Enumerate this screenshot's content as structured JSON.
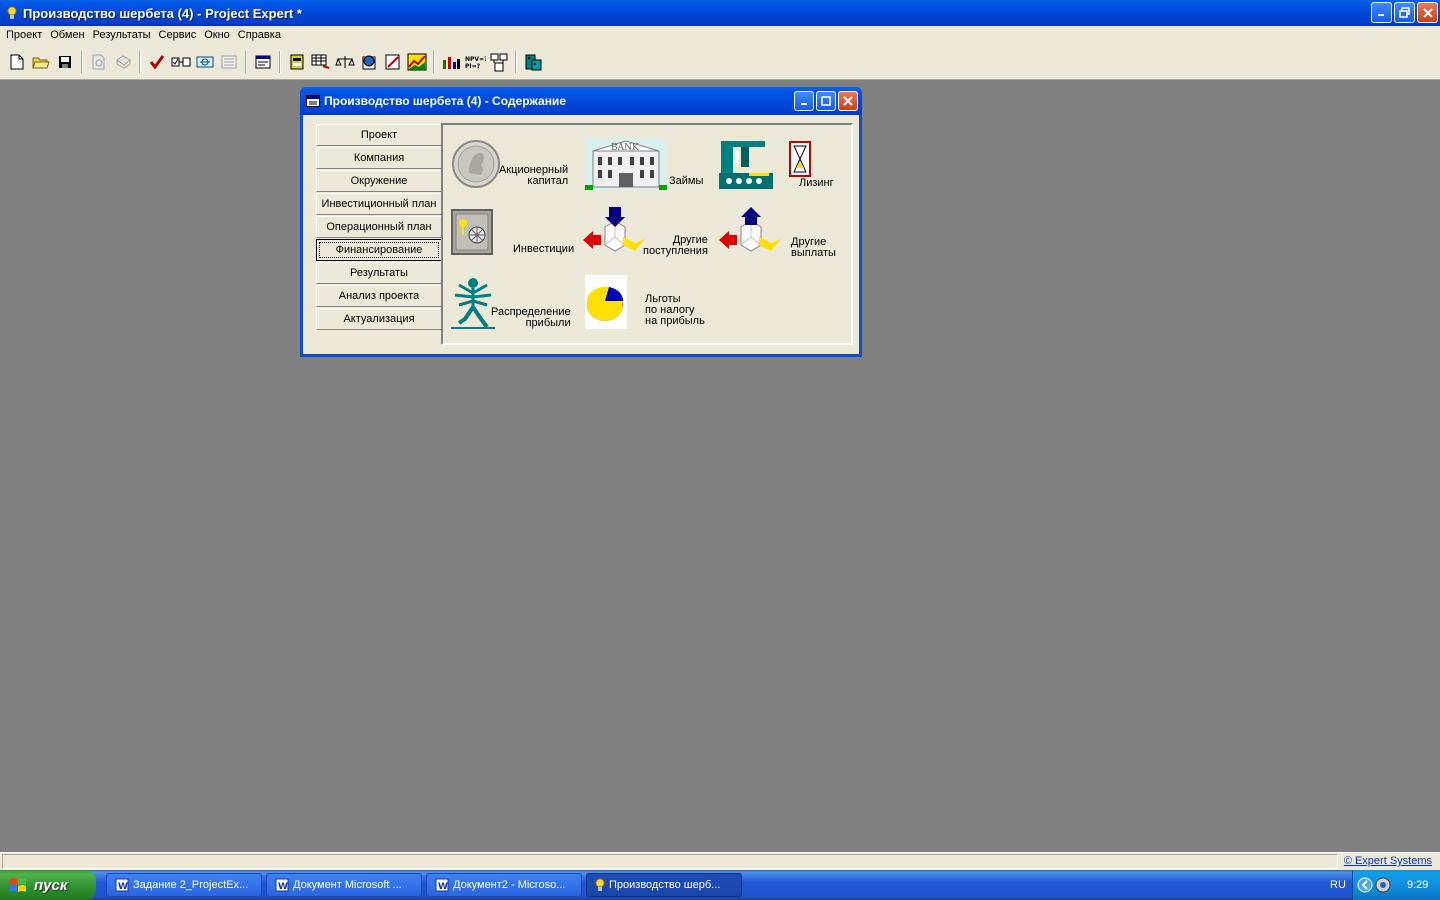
{
  "app": {
    "title": "Производство шербета (4) - Project Expert *"
  },
  "menu": [
    "Проект",
    "Обмен",
    "Результаты",
    "Сервис",
    "Окно",
    "Справка"
  ],
  "content_window": {
    "title": "Производство шербета (4) - Содержание",
    "nav": [
      "Проект",
      "Компания",
      "Окружение",
      "Инвестиционный план",
      "Операционный план",
      "Финансирование",
      "Результаты",
      "Анализ проекта",
      "Актуализация"
    ],
    "active_nav": "Финансирование",
    "items": {
      "equity": [
        "Акционерный",
        "капитал"
      ],
      "loans": [
        "Займы"
      ],
      "leasing": [
        "Лизинг"
      ],
      "investments": [
        "Инвестиции"
      ],
      "other_income": [
        "Другие",
        "поступления"
      ],
      "other_payments": [
        "Другие",
        "выплаты"
      ],
      "profit_distribution": [
        "Распределение",
        "прибыли"
      ],
      "tax_benefits": [
        "Льготы",
        "по налогу",
        "на прибыль"
      ],
      "bank_sign": "BANK"
    }
  },
  "statusbar": {
    "brand": "© Expert Systems"
  },
  "taskbar": {
    "start_label": "пуск",
    "tasks": [
      "Задание 2_ProjectEx...",
      "Документ Microsoft ...",
      "Документ2 - Microso...",
      "Производство шерб..."
    ],
    "lang": "RU",
    "clock": "9:29"
  }
}
